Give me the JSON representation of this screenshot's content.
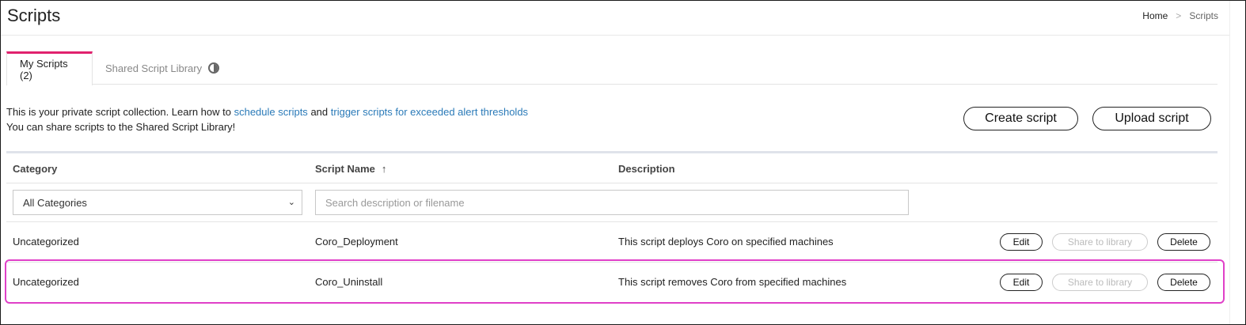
{
  "header": {
    "title": "Scripts",
    "breadcrumb": {
      "home": "Home",
      "separator": ">",
      "current": "Scripts"
    }
  },
  "tabs": [
    {
      "label": "My Scripts (2)",
      "active": true
    },
    {
      "label": "Shared Script Library",
      "active": false,
      "icon": "toggle-icon"
    }
  ],
  "intro": {
    "line1_prefix": "This is your private script collection. Learn how to",
    "link1": "schedule scripts",
    "line1_mid": "and",
    "link2": "trigger scripts for exceeded alert thresholds",
    "line2": "You can share scripts to the Shared Script Library!"
  },
  "actions": {
    "create_label": "Create script",
    "upload_label": "Upload script"
  },
  "table": {
    "columns": {
      "category": "Category",
      "script_name": "Script Name",
      "description": "Description"
    },
    "sort_icon": "↑",
    "filters": {
      "category_selected": "All Categories",
      "search_placeholder": "Search description or filename"
    },
    "rows": [
      {
        "category": "Uncategorized",
        "name": "Coro_Deployment",
        "description": "This script deploys Coro on specified machines",
        "edit": "Edit",
        "share": "Share to library",
        "delete": "Delete"
      },
      {
        "category": "Uncategorized",
        "name": "Coro_Uninstall",
        "description": "This script removes Coro from specified machines",
        "edit": "Edit",
        "share": "Share to library",
        "delete": "Delete"
      }
    ]
  },
  "colors": {
    "accent": "#e0226e",
    "link": "#2a7ab8",
    "highlight": "#e040c8"
  }
}
